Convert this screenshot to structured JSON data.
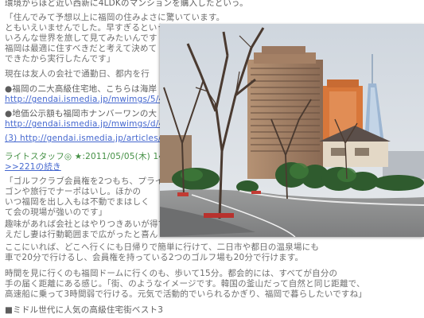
{
  "article": {
    "lines": [
      {
        "text": "環境からほど近い西新に4LDKのマンションを購入したという。"
      },
      {
        "text": "「住んでみて予想以上に福岡の住みよさに驚いています。"
      },
      {
        "text": "ともいえいませんでした。早すぎるという"
      },
      {
        "text": "いろんな世界を旅して見てみたいんです"
      },
      {
        "text": "福岡は最適に住すべきだと考えて決めて"
      },
      {
        "text": "できたから実行したんです」"
      },
      {
        "text": "現在は友人の会社で通勤日、都内を行"
      },
      {
        "text": "●福岡の二大高級住宅地、こちらは海岸"
      },
      {
        "text": "http://gendai.ismedia.jp/mwimgs/5/4/"
      },
      {
        "text": "●地価公示額も福岡市ナンバーワンの大"
      },
      {
        "text": "http://gendai.ismedia.jp/mwimgs/d/4/"
      },
      {
        "text": "(3) http://gendai.ismedia.jp/articles/-/341"
      },
      {
        "text": "ライトスタッフ◎ ★:2011/05/05(木) 14:5"
      },
      {
        "text": ">>221の続き"
      },
      {
        "text": "「ゴルフクラブ会員権を2つもち、プライベー"
      },
      {
        "text": "ゴンや旅行でナーポはいし。ほかの"
      },
      {
        "text": "いつ福岡を出し入もは不動でまはしく"
      },
      {
        "text": "て会の現場が強いのです」"
      },
      {
        "text": "趣味があれば会社とはやりつきあいが得で"
      },
      {
        "text": "えだし妻は行動範囲まで広がったと喜ん"
      },
      {
        "text": "ここにいれば、どこへ行くにも日帰りで簡単に行けて、二日市や都日の温泉場にも"
      },
      {
        "text": "車で20分で行けるし、会員権を持っている2つのゴルフ場も20分で行けます。"
      },
      {
        "text": "時間を見に行くのも福岡ドームに行くのも、歩いて15分。都会的には、すべてが自分の"
      },
      {
        "text": "手の届く距離にある感じ。「街、のようなイメージです。韓国の釜山だって自然と同じ距離で、"
      },
      {
        "text": "高速船に乗って3時間弱で行ける。元気で活動的でいられるかぎり、福岡で暮らしたいですね」"
      },
      {
        "text": "■ミドル世代に人気の高級住宅街ベスト3"
      }
    ],
    "meta_tail": "1:4:",
    "suffix_tail": "海岸"
  }
}
